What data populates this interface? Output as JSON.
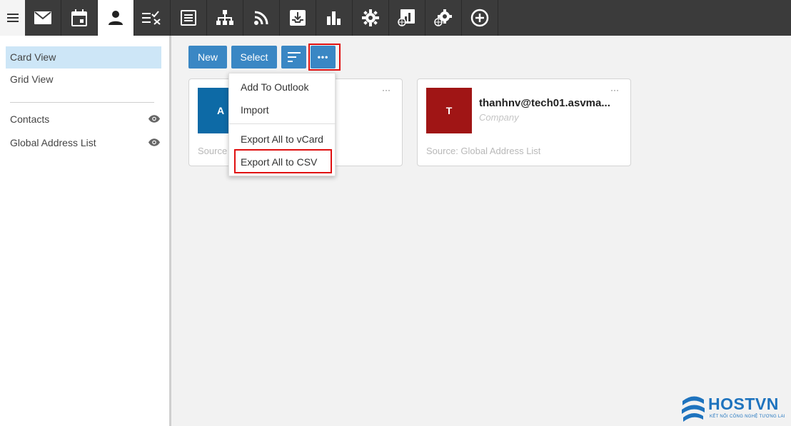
{
  "toolbar": {
    "icons": [
      "menu-icon",
      "mail-icon",
      "calendar-icon",
      "contacts-icon",
      "tasks-icon",
      "notes-icon",
      "org-chart-icon",
      "rss-icon",
      "archive-icon",
      "reports-icon",
      "settings-icon",
      "domain-reports-icon",
      "domain-settings-icon",
      "add-icon"
    ],
    "active": "contacts-icon"
  },
  "sidebar": {
    "views": [
      {
        "label": "Card View",
        "active": true
      },
      {
        "label": "Grid View",
        "active": false
      }
    ],
    "sources": [
      {
        "label": "Contacts"
      },
      {
        "label": "Global Address List"
      }
    ]
  },
  "actions": {
    "new_label": "New",
    "select_label": "Select",
    "more_label": "•••"
  },
  "menu": {
    "items": [
      "Add To Outlook",
      "Import",
      "Export All to vCard",
      "Export All to CSV"
    ]
  },
  "cards": [
    {
      "initial": "A",
      "name": "",
      "company": "",
      "source": "Source",
      "color": "#0d6aa6",
      "dots": "···"
    },
    {
      "initial": "T",
      "name": "thanhnv@tech01.asvma...",
      "company": "Company",
      "source": "Source: Global Address List",
      "color": "#a01515",
      "dots": "···"
    }
  ],
  "logo": {
    "name": "HOSTVN",
    "tagline": "KẾT NỐI CÔNG NGHỆ TƯƠNG LAI"
  },
  "colors": {
    "primary": "#3a87c4",
    "highlight": "#e01010",
    "toolbar": "#3b3b3b"
  }
}
